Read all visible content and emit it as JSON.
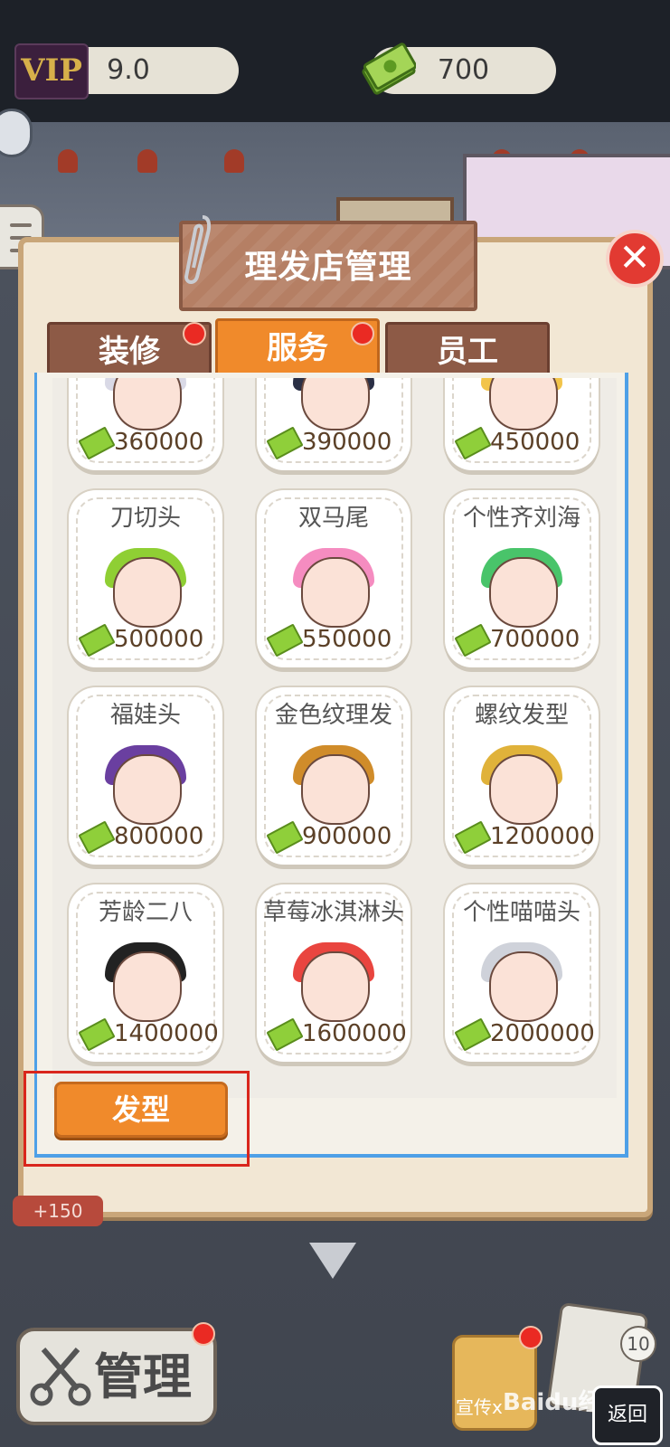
{
  "hud": {
    "vip_badge": "VIP",
    "vip_value": "9.0",
    "cash_value": "700"
  },
  "panel": {
    "title": "理发店管理",
    "close_label": "✕"
  },
  "tabs": [
    {
      "label": "装修",
      "has_dot": true
    },
    {
      "label": "服务",
      "has_dot": true,
      "active": true
    },
    {
      "label": "员工",
      "has_dot": false
    }
  ],
  "items": [
    {
      "name": "",
      "price": "360000",
      "hair_color": "#d9d9e6"
    },
    {
      "name": "",
      "price": "390000",
      "hair_color": "#2a2f45"
    },
    {
      "name": "",
      "price": "450000",
      "hair_color": "#f2c44a"
    },
    {
      "name": "刀切头",
      "price": "500000",
      "hair_color": "#8fcf34"
    },
    {
      "name": "双马尾",
      "price": "550000",
      "hair_color": "#f58cc0"
    },
    {
      "name": "个性齐刘海",
      "price": "700000",
      "hair_color": "#49c46a"
    },
    {
      "name": "福娃头",
      "price": "800000",
      "hair_color": "#6a3fa0"
    },
    {
      "name": "金色纹理发",
      "price": "900000",
      "hair_color": "#d08c2a"
    },
    {
      "name": "螺纹发型",
      "price": "1200000",
      "hair_color": "#e0b23a"
    },
    {
      "name": "芳龄二八",
      "price": "1400000",
      "hair_color": "#222222"
    },
    {
      "name": "草莓冰淇淋头",
      "price": "1600000",
      "hair_color": "#e9453f"
    },
    {
      "name": "个性喵喵头",
      "price": "2000000",
      "hair_color": "#cfd2da"
    }
  ],
  "category_button": "发型",
  "bottom": {
    "reward": "+150",
    "manage_label": "管理",
    "promo_label": "宣传x",
    "task_count": "10",
    "watermark": "Baidu经验",
    "back_label": "返回"
  },
  "colors": {
    "accent": "#f08a2b",
    "tab_inactive": "#8d5a46",
    "panel": "#f2e7d4",
    "highlight": "#d9261c"
  }
}
